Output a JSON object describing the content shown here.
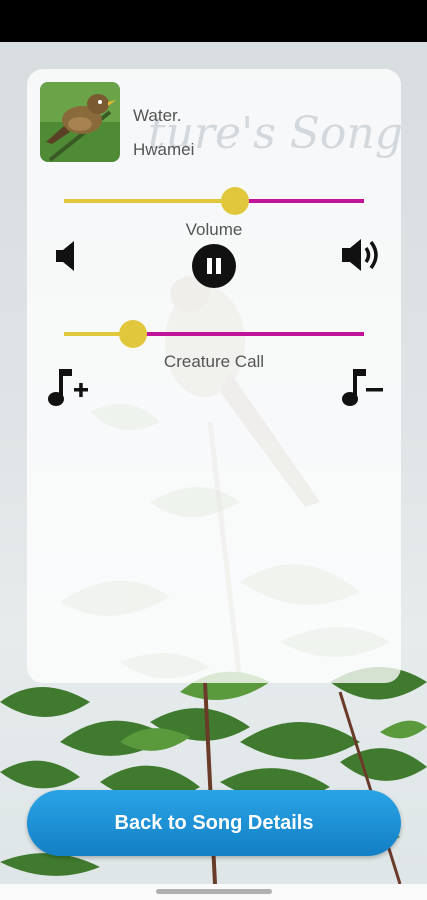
{
  "player": {
    "song_title": "Water.",
    "artist": "Hwamei",
    "watermark": "ture's Song",
    "volume_label": "Volume",
    "volume_level": 0.57,
    "creature_call_label": "Creature Call",
    "creature_call_level": 0.23,
    "play_state": "playing"
  },
  "buttons": {
    "back_label": "Back to Song Details"
  },
  "icons": {
    "volume_down": "volume-down-icon",
    "volume_up": "volume-up-icon",
    "pause": "pause-icon",
    "add_music": "music-note-plus-icon",
    "remove_music": "music-note-minus-icon"
  },
  "colors": {
    "slider_active": "#e1c73c",
    "slider_inactive": "#c2149b",
    "button_blue": "#1e90d6"
  }
}
